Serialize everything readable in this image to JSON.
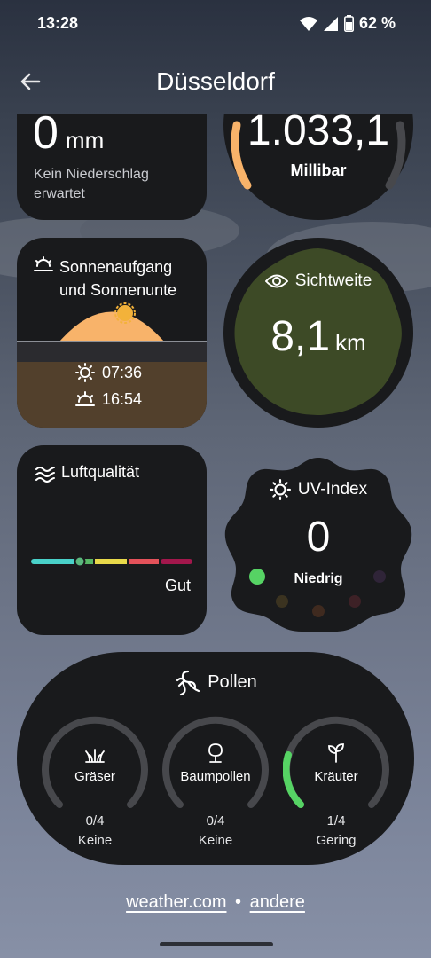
{
  "status": {
    "time": "13:28",
    "battery": "62 %"
  },
  "header": {
    "city": "Düsseldorf"
  },
  "precip": {
    "value": "0",
    "unit": "mm",
    "desc_line1": "Kein Niederschlag",
    "desc_line2": "erwartet"
  },
  "pressure": {
    "value": "1.033,1",
    "unit": "Millibar"
  },
  "sun": {
    "title_line1": "Sonnenaufgang",
    "title_line2": "und Sonnenunte",
    "sunrise": "07:36",
    "sunset": "16:54"
  },
  "visibility": {
    "title": "Sichtweite",
    "value": "8,1",
    "unit": "km"
  },
  "air": {
    "title": "Luftqualität",
    "rating": "Gut",
    "level": 0.3
  },
  "uv": {
    "title": "UV-Index",
    "value": "0",
    "rating": "Niedrig"
  },
  "pollen": {
    "title": "Pollen",
    "items": [
      {
        "name": "Gräser",
        "value": "0/4",
        "label": "Keine",
        "fraction": 0
      },
      {
        "name": "Baumpollen",
        "value": "0/4",
        "label": "Keine",
        "fraction": 0
      },
      {
        "name": "Kräuter",
        "value": "1/4",
        "label": "Gering",
        "fraction": 0.25
      }
    ]
  },
  "footer": {
    "source": "weather.com",
    "separator": "•",
    "other": "andere"
  },
  "colors": {
    "accent_orange": "#f8b36a",
    "sun_yellow": "#f3b23a",
    "pollen_green": "#56d364",
    "visibility_green": "#3d4a26"
  }
}
